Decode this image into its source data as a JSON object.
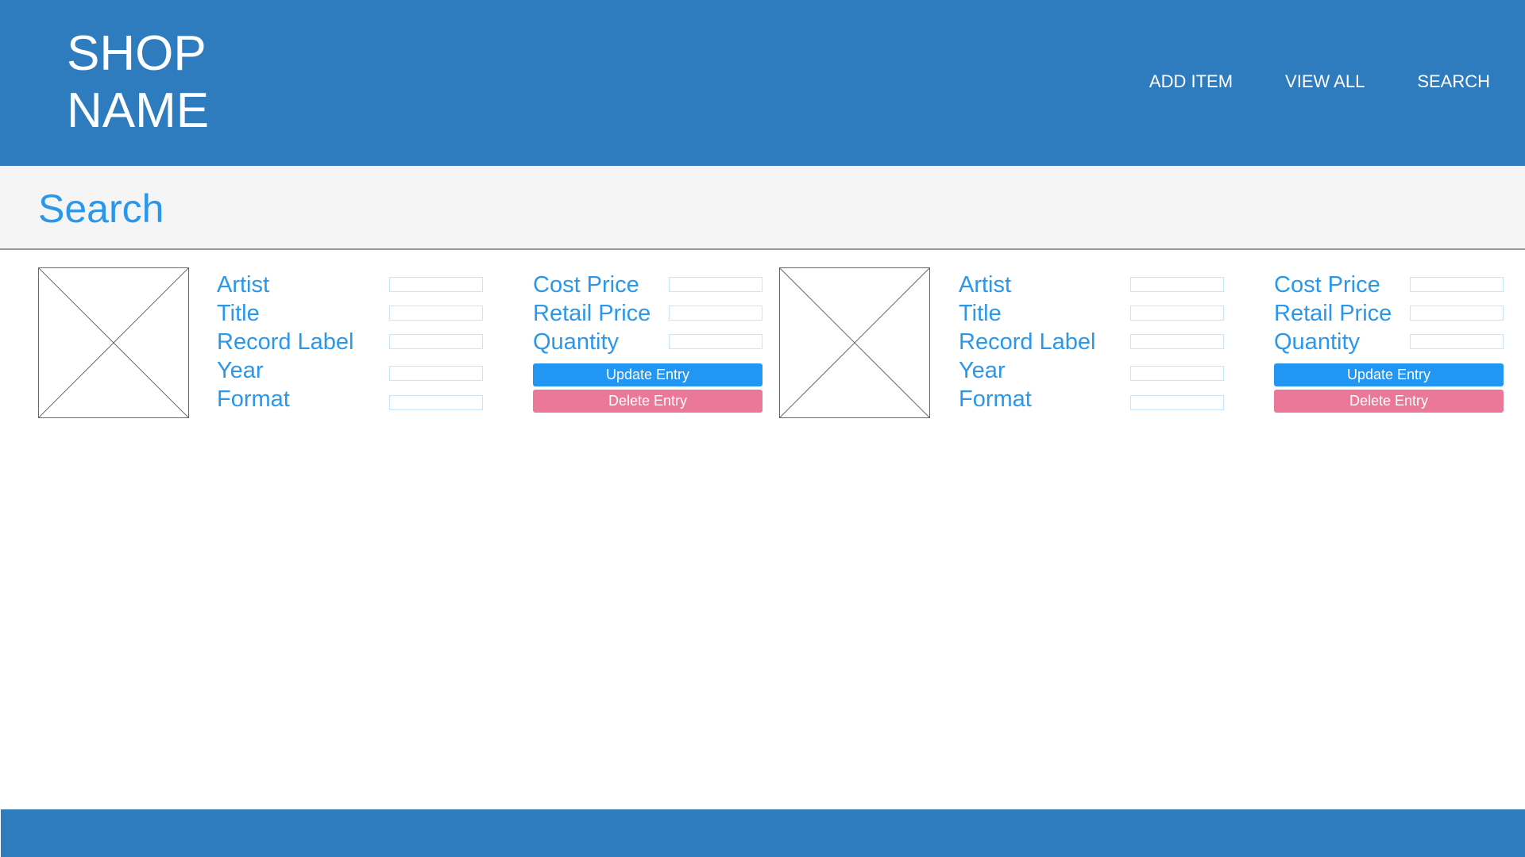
{
  "header": {
    "shop_name_line1": "SHOP",
    "shop_name_line2": "NAME",
    "nav": {
      "add_item": "ADD ITEM",
      "view_all": "VIEW ALL",
      "search": "SEARCH"
    }
  },
  "page": {
    "title": "Search"
  },
  "results": [
    {
      "image_icon": "image-placeholder-icon",
      "labels": {
        "artist": "Artist",
        "title": "Title",
        "record_label": "Record Label",
        "year": "Year",
        "format": "Format",
        "cost_price": "Cost Price",
        "retail_price": "Retail Price",
        "quantity": "Quantity"
      },
      "values": {
        "artist": "",
        "title": "",
        "record_label": "",
        "year": "",
        "format": "",
        "cost_price": "",
        "retail_price": "",
        "quantity": ""
      },
      "update_label": "Update Entry",
      "delete_label": "Delete Entry"
    },
    {
      "image_icon": "image-placeholder-icon",
      "labels": {
        "artist": "Artist",
        "title": "Title",
        "record_label": "Record Label",
        "year": "Year",
        "format": "Format",
        "cost_price": "Cost Price",
        "retail_price": "Retail Price",
        "quantity": "Quantity"
      },
      "values": {
        "artist": "",
        "title": "",
        "record_label": "",
        "year": "",
        "format": "",
        "cost_price": "",
        "retail_price": "",
        "quantity": ""
      },
      "update_label": "Update Entry",
      "delete_label": "Delete Entry"
    }
  ],
  "colors": {
    "header_bg": "#2e7bbd",
    "accent_text": "#2b97ea",
    "update_button": "#2196f3",
    "delete_button": "#eb7898",
    "title_band_bg": "#f5f5f5"
  }
}
